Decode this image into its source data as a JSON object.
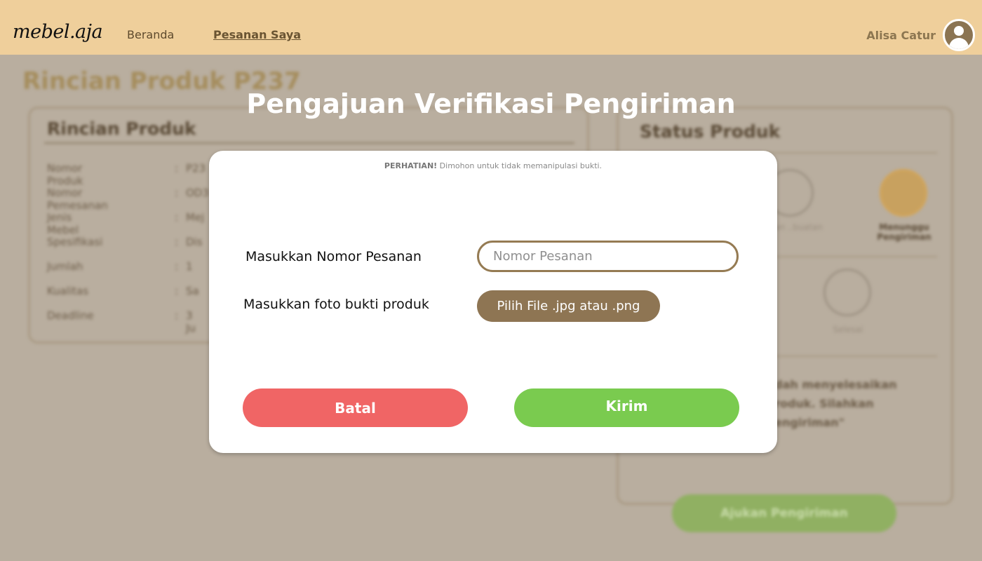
{
  "header": {
    "logo": "mebel.aja",
    "nav": {
      "home": "Beranda",
      "orders": "Pesanan Saya"
    },
    "user_name": "Alisa Catur",
    "avatar_icon": "user-avatar-icon"
  },
  "background": {
    "page_title": "Rincian Produk P237",
    "detail_card": {
      "title": "Rincian Produk",
      "rows": [
        {
          "label": "Nomor Produk",
          "sep": ":",
          "value": "P23"
        },
        {
          "label": "Nomor Pemesanan",
          "sep": ":",
          "value": "OD3"
        },
        {
          "label": "Jenis Mebel",
          "sep": ":",
          "value": "Mej"
        },
        {
          "label": "Spesifikasi",
          "sep": ":",
          "value": "Dis"
        },
        {
          "label": "Jumlah",
          "sep": ":",
          "value": "1"
        },
        {
          "label": "Kualitas",
          "sep": ":",
          "value": "Sa"
        },
        {
          "label": "Deadline",
          "sep": ":",
          "value": "3 Ju"
        }
      ]
    },
    "status_card": {
      "title": "Status Produk",
      "steps": [
        {
          "icon": "hammer-icon",
          "label": "..ngan ..buatan"
        },
        {
          "icon": "package-icon",
          "label": "Menunggu Pengiriman"
        },
        {
          "icon": "done-icon",
          "label": "Selesai"
        }
      ],
      "message": "..dah menyelesaikan ..roduk. Silahkan ..engiriman\"",
      "button": "Ajukan Pengiriman"
    }
  },
  "modal": {
    "title": "Pengajuan Verifikasi Pengiriman",
    "notice_bold": "PERHATIAN!",
    "notice_text": "Dimohon untuk tidak memanipulasi bukti.",
    "order_label": "Masukkan Nomor Pesanan",
    "order_placeholder": "Nomor Pesanan",
    "photo_label": "Masukkan foto bukti produk",
    "file_button": "Pilih File .jpg atau .png",
    "cancel_button": "Batal",
    "submit_button": "Kirim"
  },
  "colors": {
    "header_bg": "#efcf9b",
    "accent_brown": "#8e7553",
    "cancel_red": "#f06565",
    "submit_green": "#7acb4f"
  }
}
